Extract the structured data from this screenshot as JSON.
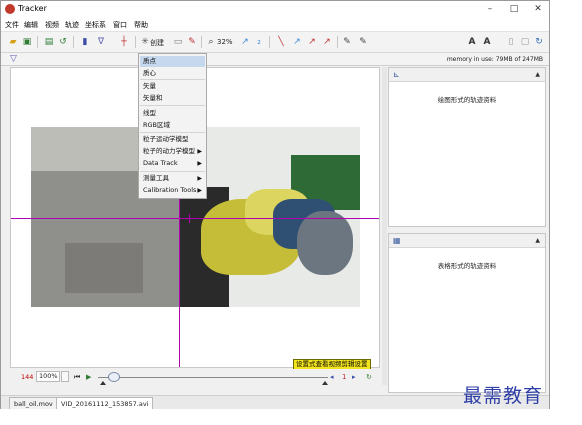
{
  "window": {
    "title": "Tracker",
    "controls": [
      "–",
      "□",
      "✕"
    ]
  },
  "menubar": [
    "文件",
    "编辑",
    "视频",
    "轨迹",
    "坐标系",
    "窗口",
    "帮助"
  ],
  "toolbar": {
    "create_label": "创建",
    "zoom_label": "32%",
    "icons": [
      "open-icon",
      "save-icon",
      "open-video-icon",
      "refresh-icon",
      "clip-settings-icon",
      "filter-icon",
      "calibration-icon",
      "create-icon",
      "clock-icon",
      "magnifier-icon",
      "trail-icon",
      "label-icon",
      "path-icon",
      "font-size-up-icon",
      "font-size-down-icon",
      "page-icon",
      "fullscreen-icon",
      "refresh-icon"
    ]
  },
  "infobar": {
    "memory": "memory in use: 79MB of 247MB"
  },
  "dropdown": {
    "items": [
      {
        "label": "质点",
        "selected": true,
        "submenu": false
      },
      {
        "label": "质心",
        "selected": false,
        "submenu": false
      },
      {
        "label": "矢量",
        "selected": false,
        "submenu": false
      },
      {
        "label": "矢量和",
        "selected": false,
        "submenu": false
      },
      {
        "label": "线型",
        "selected": false,
        "submenu": false
      },
      {
        "label": "RGB区域",
        "selected": false,
        "submenu": false
      },
      {
        "label": "粒子运动学模型",
        "selected": false,
        "submenu": false
      },
      {
        "label": "粒子的动力学模型",
        "selected": false,
        "submenu": true
      },
      {
        "label": "Data Track",
        "selected": false,
        "submenu": true
      },
      {
        "label": "测量工具",
        "selected": false,
        "submenu": true
      },
      {
        "label": "Calibration Tools",
        "selected": false,
        "submenu": true
      }
    ]
  },
  "video": {
    "overlay_text": "设置式查看视频剪辑设置"
  },
  "player": {
    "frame": "144",
    "zoom": "100%",
    "slider_position": 0.07
  },
  "panels": {
    "plot_text": "绘图形式的轨迹资料",
    "table_text": "表格形式的轨迹资料"
  },
  "tabs": [
    "ball_oil.mov",
    "VID_20161112_153857.avi"
  ],
  "watermark": "最需教育"
}
